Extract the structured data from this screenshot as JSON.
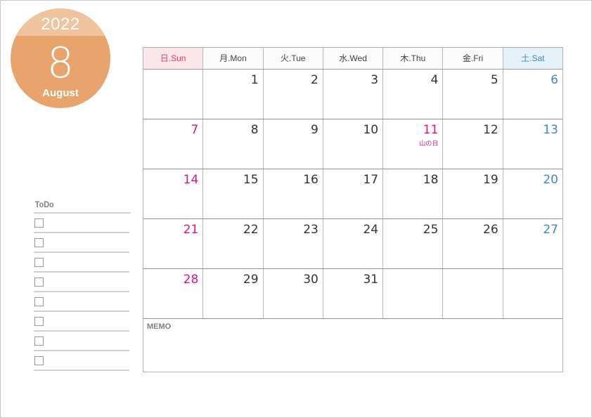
{
  "badge": {
    "year": "2022",
    "month_number": "8",
    "month_name": "August",
    "colors": {
      "top": "#f0c49e",
      "main": "#e8a46c"
    }
  },
  "todo": {
    "title": "ToDo",
    "items": [
      "",
      "",
      "",
      "",
      "",
      "",
      "",
      ""
    ]
  },
  "calendar": {
    "weekdays": [
      {
        "label": "日.Sun",
        "type": "sun"
      },
      {
        "label": "月.Mon",
        "type": ""
      },
      {
        "label": "火.Tue",
        "type": ""
      },
      {
        "label": "水.Wed",
        "type": ""
      },
      {
        "label": "木.Thu",
        "type": ""
      },
      {
        "label": "金.Fri",
        "type": ""
      },
      {
        "label": "土.Sat",
        "type": "sat"
      }
    ],
    "weeks": [
      [
        "",
        "1",
        "2",
        "3",
        "4",
        "5",
        "6"
      ],
      [
        "7",
        "8",
        "9",
        "10",
        "11",
        "12",
        "13"
      ],
      [
        "14",
        "15",
        "16",
        "17",
        "18",
        "19",
        "20"
      ],
      [
        "21",
        "22",
        "23",
        "24",
        "25",
        "26",
        "27"
      ],
      [
        "28",
        "29",
        "30",
        "31",
        "",
        "",
        ""
      ]
    ],
    "holidays": [
      {
        "day": "11",
        "name": "山の日"
      }
    ],
    "colors": {
      "sunday": "#e2157f",
      "saturday": "#3f88c6",
      "holiday": "#e2157f"
    }
  },
  "memo": {
    "label": "MEMO"
  }
}
